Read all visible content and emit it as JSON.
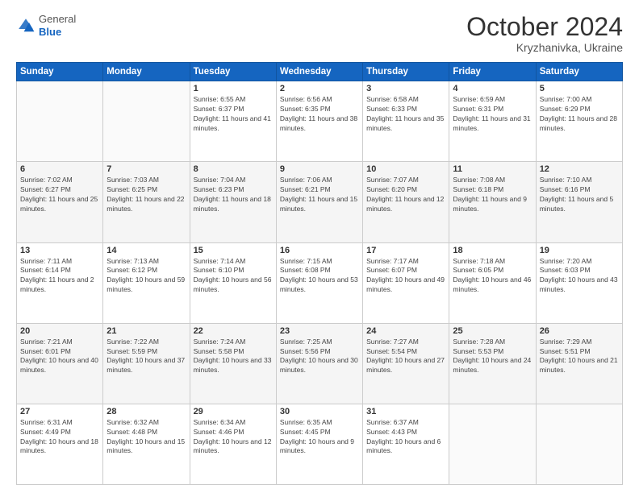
{
  "header": {
    "logo_general": "General",
    "logo_blue": "Blue",
    "month_title": "October 2024",
    "location": "Kryzhanivka, Ukraine"
  },
  "calendar": {
    "days_of_week": [
      "Sunday",
      "Monday",
      "Tuesday",
      "Wednesday",
      "Thursday",
      "Friday",
      "Saturday"
    ],
    "weeks": [
      [
        {
          "day": "",
          "info": ""
        },
        {
          "day": "",
          "info": ""
        },
        {
          "day": "1",
          "info": "Sunrise: 6:55 AM\nSunset: 6:37 PM\nDaylight: 11 hours and 41 minutes."
        },
        {
          "day": "2",
          "info": "Sunrise: 6:56 AM\nSunset: 6:35 PM\nDaylight: 11 hours and 38 minutes."
        },
        {
          "day": "3",
          "info": "Sunrise: 6:58 AM\nSunset: 6:33 PM\nDaylight: 11 hours and 35 minutes."
        },
        {
          "day": "4",
          "info": "Sunrise: 6:59 AM\nSunset: 6:31 PM\nDaylight: 11 hours and 31 minutes."
        },
        {
          "day": "5",
          "info": "Sunrise: 7:00 AM\nSunset: 6:29 PM\nDaylight: 11 hours and 28 minutes."
        }
      ],
      [
        {
          "day": "6",
          "info": "Sunrise: 7:02 AM\nSunset: 6:27 PM\nDaylight: 11 hours and 25 minutes."
        },
        {
          "day": "7",
          "info": "Sunrise: 7:03 AM\nSunset: 6:25 PM\nDaylight: 11 hours and 22 minutes."
        },
        {
          "day": "8",
          "info": "Sunrise: 7:04 AM\nSunset: 6:23 PM\nDaylight: 11 hours and 18 minutes."
        },
        {
          "day": "9",
          "info": "Sunrise: 7:06 AM\nSunset: 6:21 PM\nDaylight: 11 hours and 15 minutes."
        },
        {
          "day": "10",
          "info": "Sunrise: 7:07 AM\nSunset: 6:20 PM\nDaylight: 11 hours and 12 minutes."
        },
        {
          "day": "11",
          "info": "Sunrise: 7:08 AM\nSunset: 6:18 PM\nDaylight: 11 hours and 9 minutes."
        },
        {
          "day": "12",
          "info": "Sunrise: 7:10 AM\nSunset: 6:16 PM\nDaylight: 11 hours and 5 minutes."
        }
      ],
      [
        {
          "day": "13",
          "info": "Sunrise: 7:11 AM\nSunset: 6:14 PM\nDaylight: 11 hours and 2 minutes."
        },
        {
          "day": "14",
          "info": "Sunrise: 7:13 AM\nSunset: 6:12 PM\nDaylight: 10 hours and 59 minutes."
        },
        {
          "day": "15",
          "info": "Sunrise: 7:14 AM\nSunset: 6:10 PM\nDaylight: 10 hours and 56 minutes."
        },
        {
          "day": "16",
          "info": "Sunrise: 7:15 AM\nSunset: 6:08 PM\nDaylight: 10 hours and 53 minutes."
        },
        {
          "day": "17",
          "info": "Sunrise: 7:17 AM\nSunset: 6:07 PM\nDaylight: 10 hours and 49 minutes."
        },
        {
          "day": "18",
          "info": "Sunrise: 7:18 AM\nSunset: 6:05 PM\nDaylight: 10 hours and 46 minutes."
        },
        {
          "day": "19",
          "info": "Sunrise: 7:20 AM\nSunset: 6:03 PM\nDaylight: 10 hours and 43 minutes."
        }
      ],
      [
        {
          "day": "20",
          "info": "Sunrise: 7:21 AM\nSunset: 6:01 PM\nDaylight: 10 hours and 40 minutes."
        },
        {
          "day": "21",
          "info": "Sunrise: 7:22 AM\nSunset: 5:59 PM\nDaylight: 10 hours and 37 minutes."
        },
        {
          "day": "22",
          "info": "Sunrise: 7:24 AM\nSunset: 5:58 PM\nDaylight: 10 hours and 33 minutes."
        },
        {
          "day": "23",
          "info": "Sunrise: 7:25 AM\nSunset: 5:56 PM\nDaylight: 10 hours and 30 minutes."
        },
        {
          "day": "24",
          "info": "Sunrise: 7:27 AM\nSunset: 5:54 PM\nDaylight: 10 hours and 27 minutes."
        },
        {
          "day": "25",
          "info": "Sunrise: 7:28 AM\nSunset: 5:53 PM\nDaylight: 10 hours and 24 minutes."
        },
        {
          "day": "26",
          "info": "Sunrise: 7:29 AM\nSunset: 5:51 PM\nDaylight: 10 hours and 21 minutes."
        }
      ],
      [
        {
          "day": "27",
          "info": "Sunrise: 6:31 AM\nSunset: 4:49 PM\nDaylight: 10 hours and 18 minutes."
        },
        {
          "day": "28",
          "info": "Sunrise: 6:32 AM\nSunset: 4:48 PM\nDaylight: 10 hours and 15 minutes."
        },
        {
          "day": "29",
          "info": "Sunrise: 6:34 AM\nSunset: 4:46 PM\nDaylight: 10 hours and 12 minutes."
        },
        {
          "day": "30",
          "info": "Sunrise: 6:35 AM\nSunset: 4:45 PM\nDaylight: 10 hours and 9 minutes."
        },
        {
          "day": "31",
          "info": "Sunrise: 6:37 AM\nSunset: 4:43 PM\nDaylight: 10 hours and 6 minutes."
        },
        {
          "day": "",
          "info": ""
        },
        {
          "day": "",
          "info": ""
        }
      ]
    ]
  }
}
